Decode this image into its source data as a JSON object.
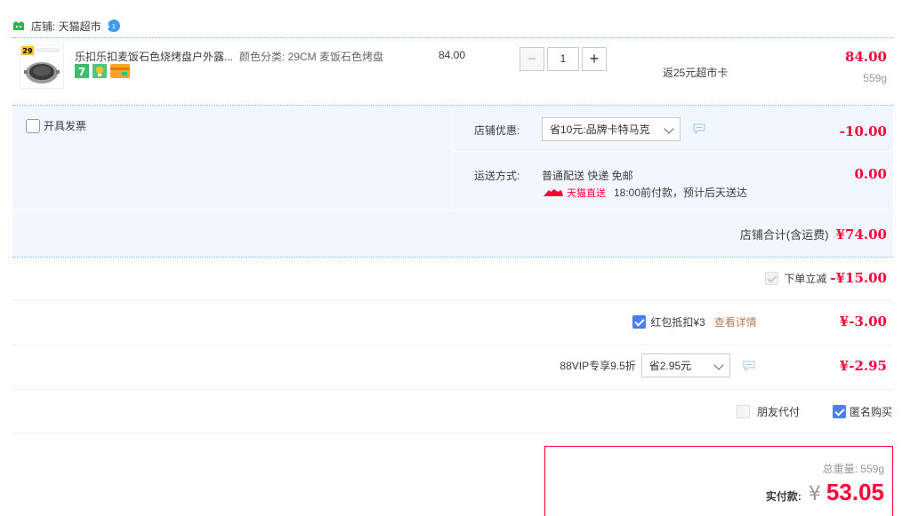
{
  "shop": {
    "label": "店铺: 天猫超市",
    "shop_icon": "tmall-shop-icon",
    "chat_icon": "wangwang-chat-icon"
  },
  "item": {
    "title": "乐扣乐扣麦饭石色烧烤盘户外露...",
    "sku": "颜色分类: 29CM 麦饭石色烤盘",
    "unit_price": "84.00",
    "quantity": "1",
    "rebate": "返25元超市卡",
    "total": "84.00",
    "weight": "559g",
    "thumb_text": "29",
    "thumb_caption": "麦饭石色烤盘",
    "badges": [
      "7-day-return-icon",
      "guarantee-icon",
      "credit-card-icon"
    ]
  },
  "invoice": {
    "label": "开具发票"
  },
  "shop_discount": {
    "label": "店铺优惠:",
    "selected": "省10元:品牌卡特马克",
    "amount": "-10.00"
  },
  "shipping": {
    "label": "运送方式:",
    "method": "普通配送 快递 免邮",
    "tag": "天猫直送",
    "eta": "18:00前付款，预计后天送达",
    "fee": "0.00"
  },
  "shop_total": {
    "label": "店铺合计(含运费)",
    "value": "¥74.00"
  },
  "order_instant": {
    "label": "下单立减",
    "value": "-¥15.00"
  },
  "red_packet": {
    "label": "红包抵扣¥3",
    "link": "查看详情",
    "value": "¥-3.00"
  },
  "vip": {
    "label": "88VIP专享9.5折",
    "selected": "省2.95元",
    "value": "¥-2.95"
  },
  "friend_pay": {
    "label": "朋友代付"
  },
  "anonymous": {
    "label": "匿名购买"
  },
  "payment": {
    "weight_label": "总重量: 559g",
    "pay_label": "实付款:",
    "currency": "¥",
    "amount": "53.05"
  },
  "colors": {
    "accent": "#ff0036",
    "panel": "#f2f7ff",
    "checkbox": "#4a7ef6",
    "link": "#b3805b"
  }
}
